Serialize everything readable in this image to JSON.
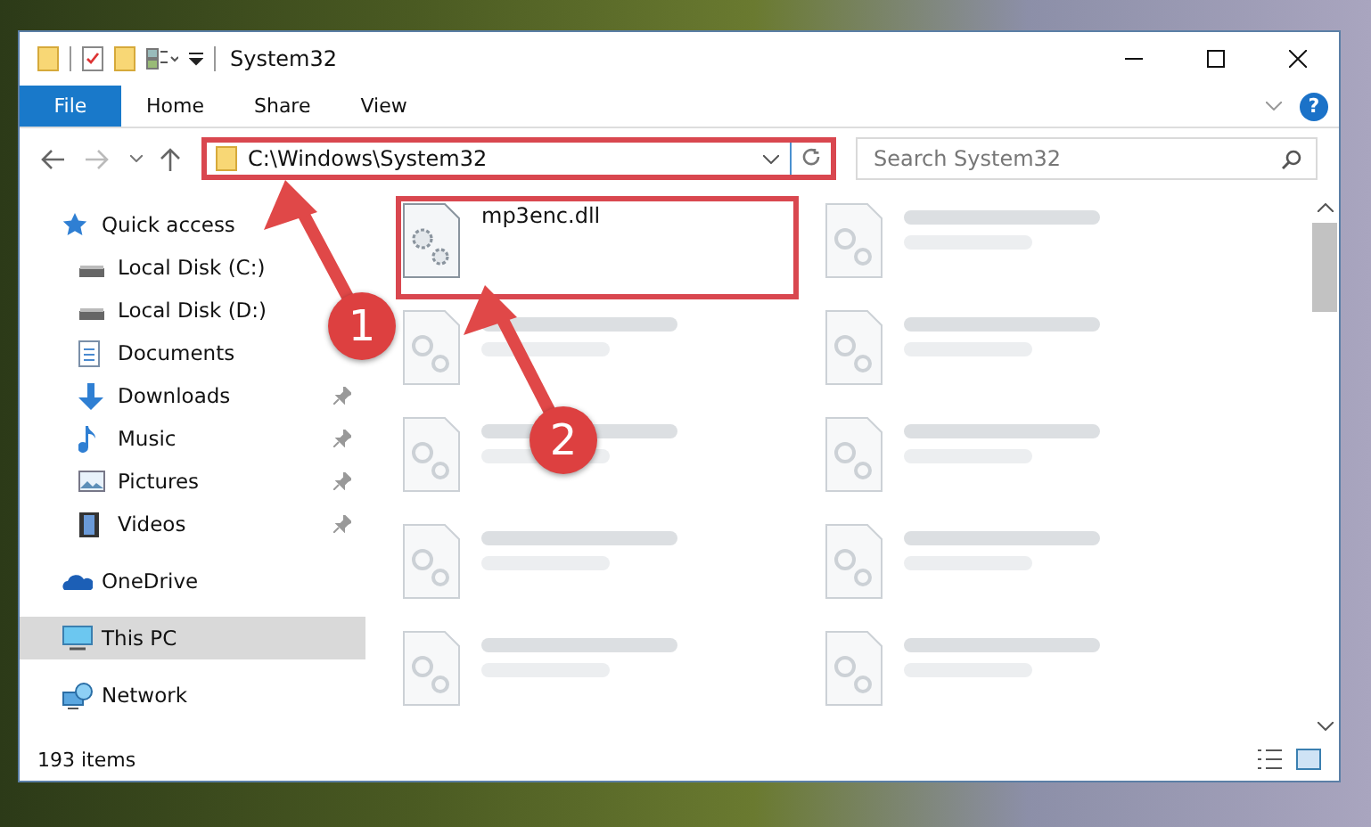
{
  "window": {
    "title": "System32"
  },
  "ribbon": {
    "tabs": [
      {
        "label": "File",
        "kind": "file",
        "selected": false
      },
      {
        "label": "Home",
        "kind": "tab",
        "selected": false
      },
      {
        "label": "Share",
        "kind": "tab",
        "selected": false
      },
      {
        "label": "View",
        "kind": "tab",
        "selected": false
      }
    ],
    "help": "?"
  },
  "address": {
    "path": "C:\\Windows\\System32",
    "highlighted": true
  },
  "search": {
    "placeholder": "Search System32"
  },
  "sidebar": {
    "items": [
      {
        "label": "Quick access",
        "kind": "star",
        "selected": false,
        "children": [
          {
            "label": "Local Disk (C:)",
            "kind": "disk",
            "pinned": false,
            "selected": false
          },
          {
            "label": "Local Disk (D:)",
            "kind": "disk",
            "pinned": false,
            "selected": false
          },
          {
            "label": "Documents",
            "kind": "docs",
            "pinned": false,
            "selected": false
          },
          {
            "label": "Downloads",
            "kind": "download",
            "pinned": true,
            "selected": false
          },
          {
            "label": "Music",
            "kind": "music",
            "pinned": true,
            "selected": false
          },
          {
            "label": "Pictures",
            "kind": "pictures",
            "pinned": true,
            "selected": false
          },
          {
            "label": "Videos",
            "kind": "videos",
            "pinned": true,
            "selected": false
          }
        ]
      },
      {
        "label": "OneDrive",
        "kind": "cloud",
        "selected": false
      },
      {
        "label": "This PC",
        "kind": "pc",
        "selected": true
      },
      {
        "label": "Network",
        "kind": "network",
        "selected": false
      }
    ]
  },
  "files": [
    {
      "kind": "file",
      "name": "mp3enc.dll",
      "highlighted": true
    },
    {
      "kind": "blurred",
      "highlighted": false
    },
    {
      "kind": "blurred",
      "highlighted": false
    },
    {
      "kind": "blurred",
      "highlighted": false
    },
    {
      "kind": "blurred",
      "highlighted": false
    },
    {
      "kind": "blurred",
      "highlighted": false
    },
    {
      "kind": "blurred",
      "highlighted": false
    },
    {
      "kind": "blurred",
      "highlighted": false
    },
    {
      "kind": "blurred",
      "highlighted": false
    },
    {
      "kind": "blurred",
      "highlighted": false
    }
  ],
  "status_bar": {
    "count": "193 items"
  },
  "annotations": [
    {
      "label": "1"
    },
    {
      "label": "2"
    }
  ]
}
